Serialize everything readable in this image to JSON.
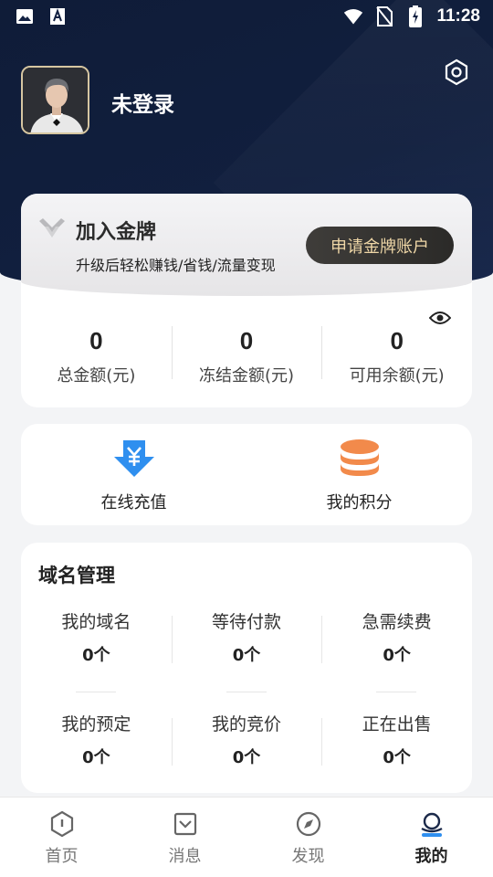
{
  "status_bar": {
    "time": "11:28",
    "left_icons": [
      "image-icon",
      "text-a-icon"
    ],
    "right_icons": [
      "wifi-icon",
      "no-sim-icon",
      "battery-charging-icon"
    ]
  },
  "profile": {
    "name": "未登录"
  },
  "gold_card": {
    "title": "加入金牌",
    "subtitle": "升级后轻松赚钱/省钱/流量变现",
    "apply_button": "申请金牌账户",
    "stats": [
      {
        "value": "0",
        "label": "总金额(元)"
      },
      {
        "value": "0",
        "label": "冻结金额(元)"
      },
      {
        "value": "0",
        "label": "可用余额(元)"
      }
    ]
  },
  "quick_actions": [
    {
      "label": "在线充值",
      "icon": "yen-download-icon"
    },
    {
      "label": "我的积分",
      "icon": "coin-stack-icon"
    }
  ],
  "domain_management": {
    "title": "域名管理",
    "items": [
      {
        "label": "我的域名",
        "value": "0个"
      },
      {
        "label": "等待付款",
        "value": "0个"
      },
      {
        "label": "急需续费",
        "value": "0个"
      },
      {
        "label": "我的预定",
        "value": "0个"
      },
      {
        "label": "我的竞价",
        "value": "0个"
      },
      {
        "label": "正在出售",
        "value": "0个"
      }
    ]
  },
  "bottom_nav": [
    {
      "label": "首页",
      "icon": "home-hexagon-icon"
    },
    {
      "label": "消息",
      "icon": "message-icon"
    },
    {
      "label": "发现",
      "icon": "compass-icon"
    },
    {
      "label": "我的",
      "icon": "profile-icon",
      "active": true
    }
  ],
  "colors": {
    "hero_bg": "#0f1c38",
    "gold_text": "#efd7a7",
    "accent_blue": "#2f8fef",
    "accent_orange": "#f28a4b"
  }
}
